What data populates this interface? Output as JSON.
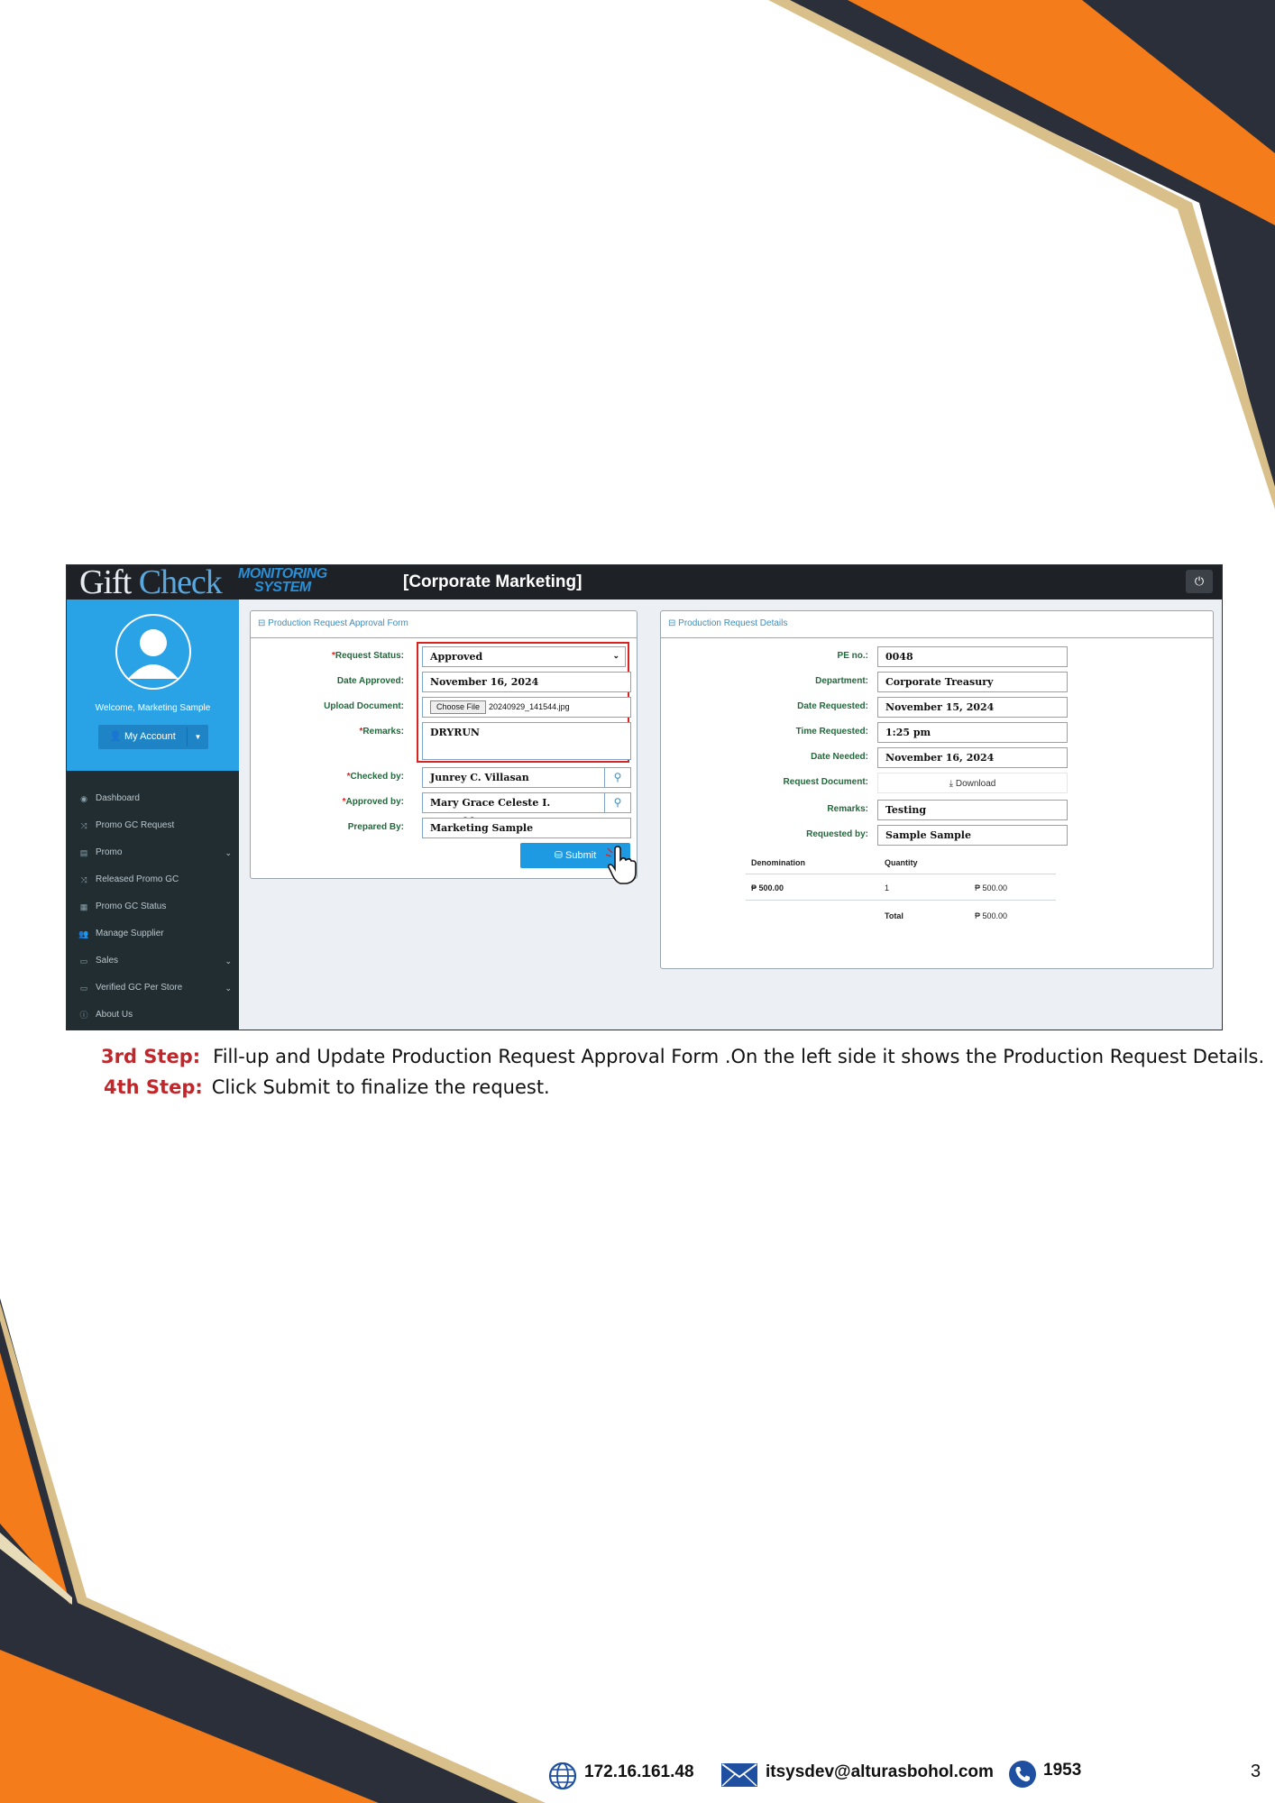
{
  "app": {
    "logo_text_gift": "Gift ",
    "logo_text_check": "Check",
    "logo_text_monitoring": "MONITORING",
    "logo_text_system": "SYSTEM",
    "title": "[Corporate Marketing]"
  },
  "sidebar": {
    "welcome": "Welcome, Marketing Sample",
    "account_button": "My Account",
    "items": [
      {
        "label": "Dashboard",
        "icon": "dashboard-icon",
        "has_chevron": false
      },
      {
        "label": "Promo GC Request",
        "icon": "shuffle-icon",
        "has_chevron": false
      },
      {
        "label": "Promo",
        "icon": "table-icon",
        "has_chevron": true
      },
      {
        "label": "Released Promo GC",
        "icon": "shuffle-icon",
        "has_chevron": false
      },
      {
        "label": "Promo GC Status",
        "icon": "grid-icon",
        "has_chevron": false
      },
      {
        "label": "Manage Supplier",
        "icon": "users-icon",
        "has_chevron": false
      },
      {
        "label": "Sales",
        "icon": "monitor-icon",
        "has_chevron": true
      },
      {
        "label": "Verified GC Per Store",
        "icon": "monitor-icon",
        "has_chevron": true
      },
      {
        "label": "About Us",
        "icon": "info-icon",
        "has_chevron": false
      }
    ]
  },
  "approval_form": {
    "title": "Production Request Approval Form",
    "request_status_label": "Request Status:",
    "request_status_value": "Approved",
    "date_approved_label": "Date Approved:",
    "date_approved_value": "November 16, 2024",
    "upload_label": "Upload Document:",
    "choose_file_button": "Choose File",
    "file_name": "20240929_141544.jpg",
    "remarks_label": "Remarks:",
    "remarks_value": "DRYRUN",
    "checked_by_label": "Checked by:",
    "checked_by_value": "Junrey C. Villasan",
    "approved_by_label": "Approved by:",
    "approved_by_value": "Mary Grace Celeste I. Bernaldez",
    "prepared_by_label": "Prepared By:",
    "prepared_by_value": "Marketing Sample",
    "submit_label": "Submit"
  },
  "details": {
    "title": "Production Request Details",
    "pe_no_label": "PE no.:",
    "pe_no_value": "0048",
    "department_label": "Department:",
    "department_value": "Corporate Treasury",
    "date_requested_label": "Date Requested:",
    "date_requested_value": "November 15, 2024",
    "time_requested_label": "Time Requested:",
    "time_requested_value": "1:25 pm",
    "date_needed_label": "Date Needed:",
    "date_needed_value": "November 16, 2024",
    "request_document_label": "Request Document:",
    "download_label": "Download",
    "remarks_label": "Remarks:",
    "remarks_value": "Testing",
    "requested_by_label": "Requested by:",
    "requested_by_value": "Sample Sample",
    "table": {
      "headers": [
        "Denomination",
        "Quantity"
      ],
      "row": {
        "denomination": "₱ 500.00",
        "quantity": "1",
        "amount": "₱ 500.00"
      },
      "total_label": "Total",
      "total_value": "₱ 500.00"
    }
  },
  "steps": {
    "step3_label": "3rd Step:",
    "step3_text": "Fill-up and Update Production Request Approval Form .On the left side it shows the Production Request Details.",
    "step4_label": "4th Step:",
    "step4_text": "Click Submit to finalize the request."
  },
  "footer": {
    "ip": "172.16.161.48",
    "email": "itsysdev@alturasbohol.com",
    "phone": "1953",
    "page_number": "3"
  },
  "colors": {
    "orange": "#f47c1a",
    "navy": "#2b2f3a",
    "gold": "#d9c08a",
    "accent_blue": "#1e9ae3",
    "step_red": "#c0262a"
  }
}
